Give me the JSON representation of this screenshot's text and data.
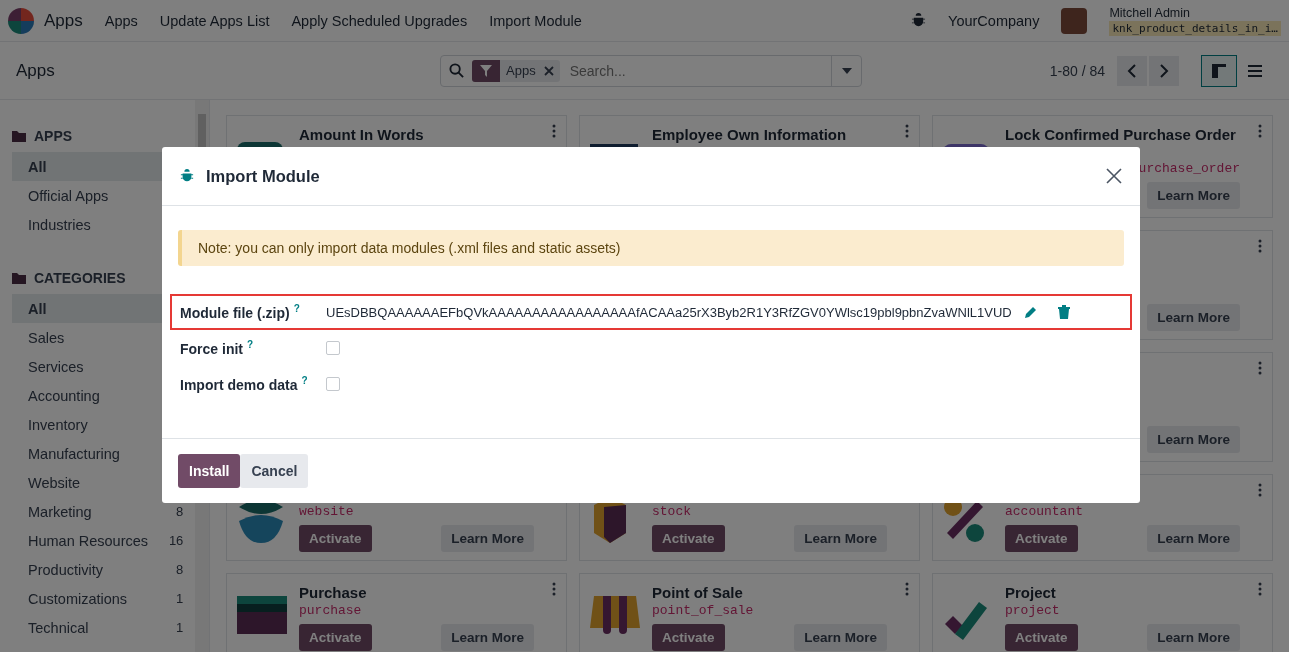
{
  "navbar": {
    "brand": "Apps",
    "menu": [
      "Apps",
      "Update Apps List",
      "Apply Scheduled Upgrades",
      "Import Module"
    ],
    "company": "YourCompany",
    "user": "Mitchell Admin",
    "database": "knk_product_details_in_i…"
  },
  "control_panel": {
    "breadcrumb": "Apps",
    "search": {
      "facet": "Apps",
      "placeholder": "Search..."
    },
    "pager": "1-80 / 84",
    "views": [
      {
        "kind": "kanban",
        "selected": true
      },
      {
        "kind": "list",
        "selected": false
      }
    ]
  },
  "sidebar": {
    "sections": [
      {
        "title": "APPS",
        "items": [
          {
            "label": "All",
            "selected": true
          },
          {
            "label": "Official Apps",
            "selected": false
          },
          {
            "label": "Industries",
            "selected": false
          }
        ]
      },
      {
        "title": "CATEGORIES",
        "items": [
          {
            "label": "All",
            "selected": true
          },
          {
            "label": "Sales",
            "selected": false
          },
          {
            "label": "Services",
            "selected": false
          },
          {
            "label": "Accounting",
            "selected": false
          },
          {
            "label": "Inventory",
            "selected": false
          },
          {
            "label": "Manufacturing",
            "selected": false
          },
          {
            "label": "Website",
            "selected": false
          },
          {
            "label": "Marketing",
            "count": "8",
            "selected": false
          },
          {
            "label": "Human Resources",
            "count": "16",
            "selected": false
          },
          {
            "label": "Productivity",
            "count": "8",
            "selected": false
          },
          {
            "label": "Customizations",
            "count": "1",
            "selected": false
          },
          {
            "label": "Technical",
            "count": "1",
            "selected": false
          }
        ]
      }
    ]
  },
  "card_rows": [
    {
      "cards": [
        {
          "name": "Amount In Words"
        },
        {
          "name": "Employee Own Information"
        },
        {
          "name": "Lock Confirmed Purchase Order",
          "technical_name": "urchase_order",
          "technical_name_cut": true,
          "buttons": [
            {
              "label": "Learn More",
              "kind": "secondary"
            }
          ]
        }
      ]
    },
    {
      "cards": [
        {
          "buttons": [
            {
              "label": "Learn More",
              "kind": "secondary"
            }
          ]
        }
      ]
    },
    {
      "cards": [
        {
          "buttons": [
            {
              "label": "Learn More",
              "kind": "secondary"
            }
          ]
        }
      ]
    },
    {
      "cards": [
        {
          "technical_name": "website",
          "buttons": [
            {
              "label": "Activate",
              "kind": "primary"
            },
            {
              "label": "Learn More",
              "kind": "secondary"
            }
          ]
        },
        {
          "technical_name": "stock",
          "buttons": [
            {
              "label": "Activate",
              "kind": "primary"
            },
            {
              "label": "Learn More",
              "kind": "secondary"
            }
          ]
        },
        {
          "technical_name": "accountant",
          "buttons": [
            {
              "label": "Activate",
              "kind": "primary"
            },
            {
              "label": "Learn More",
              "kind": "secondary"
            }
          ]
        }
      ]
    },
    {
      "cards": [
        {
          "name": "Purchase",
          "technical_name": "purchase",
          "buttons": [
            {
              "label": "Activate",
              "kind": "primary"
            },
            {
              "label": "Learn More",
              "kind": "secondary"
            }
          ]
        },
        {
          "name": "Point of Sale",
          "technical_name": "point_of_sale",
          "buttons": [
            {
              "label": "Activate",
              "kind": "primary"
            },
            {
              "label": "Learn More",
              "kind": "secondary"
            }
          ]
        },
        {
          "name": "Project",
          "technical_name": "project",
          "buttons": [
            {
              "label": "Activate",
              "kind": "primary"
            },
            {
              "label": "Learn More",
              "kind": "secondary"
            }
          ]
        }
      ]
    }
  ],
  "dialog": {
    "title": "Import Module",
    "note": "Note: you can only import data modules (.xml files and static assets)",
    "fields": [
      {
        "kind": "file",
        "label": "Module file (.zip)",
        "help": "?",
        "value": "UEsDBBQAAAAAAEFbQVkAAAAAAAAAAAAAAAAAfACAAa25rX3Byb2R1Y3RfZGV0YWlsc19pbl9pbnZvaWNlL1VUD",
        "highlighted": true
      },
      {
        "kind": "checkbox",
        "label": "Force init",
        "help": "?",
        "checked": false
      },
      {
        "kind": "checkbox",
        "label": "Import demo data",
        "help": "?",
        "checked": false
      }
    ],
    "buttons": [
      {
        "label": "Install",
        "kind": "primary"
      },
      {
        "label": "Cancel",
        "kind": "secondary"
      }
    ]
  }
}
